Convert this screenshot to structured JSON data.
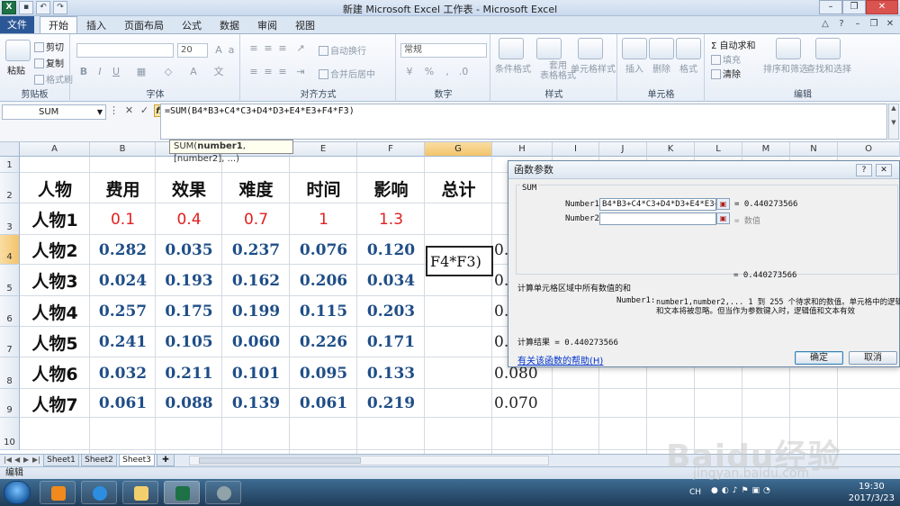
{
  "window": {
    "title": "新建 Microsoft Excel 工作表 - Microsoft Excel"
  },
  "ribbon": {
    "file_tab": "文件",
    "tabs": [
      "开始",
      "插入",
      "页面布局",
      "公式",
      "数据",
      "审阅",
      "视图"
    ],
    "clipboard": {
      "paste": "粘贴",
      "cut": "剪切",
      "copy": "复制",
      "format_painter": "格式刷",
      "label": "剪贴板"
    },
    "font": {
      "size": "20",
      "label": "字体"
    },
    "alignment": {
      "wrap": "自动换行",
      "merge": "合并后居中",
      "label": "对齐方式"
    },
    "number": {
      "format": "常规",
      "label": "数字"
    },
    "styles": {
      "conditional": "条件格式",
      "table": "套用\n表格格式",
      "cell_styles": "单元格样式",
      "label": "样式"
    },
    "cells": {
      "insert": "插入",
      "delete": "删除",
      "format": "格式",
      "label": "单元格"
    },
    "editing": {
      "autosum": "自动求和",
      "fill": "填充",
      "clear": "清除",
      "sort": "排序和筛选",
      "find": "查找和选择",
      "label": "编辑"
    }
  },
  "formula_bar": {
    "name_box": "SUM",
    "formula": "=SUM(B4*B3+C4*C3+D4*D3+E4*E3+F4*F3)",
    "tooltip_fn": "SUM(",
    "tooltip_arg1": "number1",
    "tooltip_rest": ", [number2], ...)"
  },
  "columns": [
    "A",
    "B",
    "C",
    "D",
    "E",
    "F",
    "G",
    "H",
    "I",
    "J",
    "K",
    "L",
    "M",
    "N",
    "O"
  ],
  "rows": [
    "1",
    "2",
    "3",
    "4",
    "5",
    "6",
    "7",
    "8",
    "9",
    "10"
  ],
  "grid": {
    "headers": [
      "人物",
      "费用",
      "效果",
      "难度",
      "时间",
      "影响",
      "总计"
    ],
    "weights": {
      "label": "人物1",
      "values": [
        "0.1",
        "0.4",
        "0.7",
        "1",
        "1.3"
      ]
    },
    "data": [
      {
        "name": "人物2",
        "values": [
          "0.282",
          "0.035",
          "0.237",
          "0.076",
          "0.120"
        ]
      },
      {
        "name": "人物3",
        "values": [
          "0.024",
          "0.193",
          "0.162",
          "0.206",
          "0.034"
        ]
      },
      {
        "name": "人物4",
        "values": [
          "0.257",
          "0.175",
          "0.199",
          "0.115",
          "0.203"
        ]
      },
      {
        "name": "人物5",
        "values": [
          "0.241",
          "0.105",
          "0.060",
          "0.226",
          "0.171"
        ]
      },
      {
        "name": "人物6",
        "values": [
          "0.032",
          "0.211",
          "0.101",
          "0.095",
          "0.133"
        ]
      },
      {
        "name": "人物7",
        "values": [
          "0.061",
          "0.088",
          "0.139",
          "0.061",
          "0.219"
        ]
      }
    ],
    "h_column": [
      "0.",
      "0.",
      "0.",
      "0.",
      "0.080",
      "0.070"
    ],
    "editing_text": "F4*F3)"
  },
  "dialog": {
    "title": "函数参数",
    "group": "SUM",
    "number1_label": "Number1",
    "number1_value": "B4*B3+C4*C3+D4*D3+E4*E3+F4*F",
    "number1_result": "= 0.440273566",
    "number2_label": "Number2",
    "number2_result": "= 数值",
    "total_result": "= 0.440273566",
    "description": "计算单元格区域中所有数值的和",
    "arg_desc_label": "Number1:",
    "arg_desc_line1": "number1,number2,... 1 到 255 个待求和的数值。单元格中的逻辑值",
    "arg_desc_line2": "和文本将被忽略。但当作为参数键入时，逻辑值和文本有效",
    "calc_result": "计算结果 = 0.440273566",
    "help_link": "有关该函数的帮助(H)",
    "ok": "确定",
    "cancel": "取消"
  },
  "sheets": [
    "Sheet1",
    "Sheet2",
    "Sheet3"
  ],
  "status": "编辑",
  "taskbar": {
    "lang": "CH",
    "time": "19:30",
    "date": "2017/3/23"
  },
  "watermark": {
    "main": "Baidu经验",
    "sub": "jingyan.baidu.com"
  }
}
